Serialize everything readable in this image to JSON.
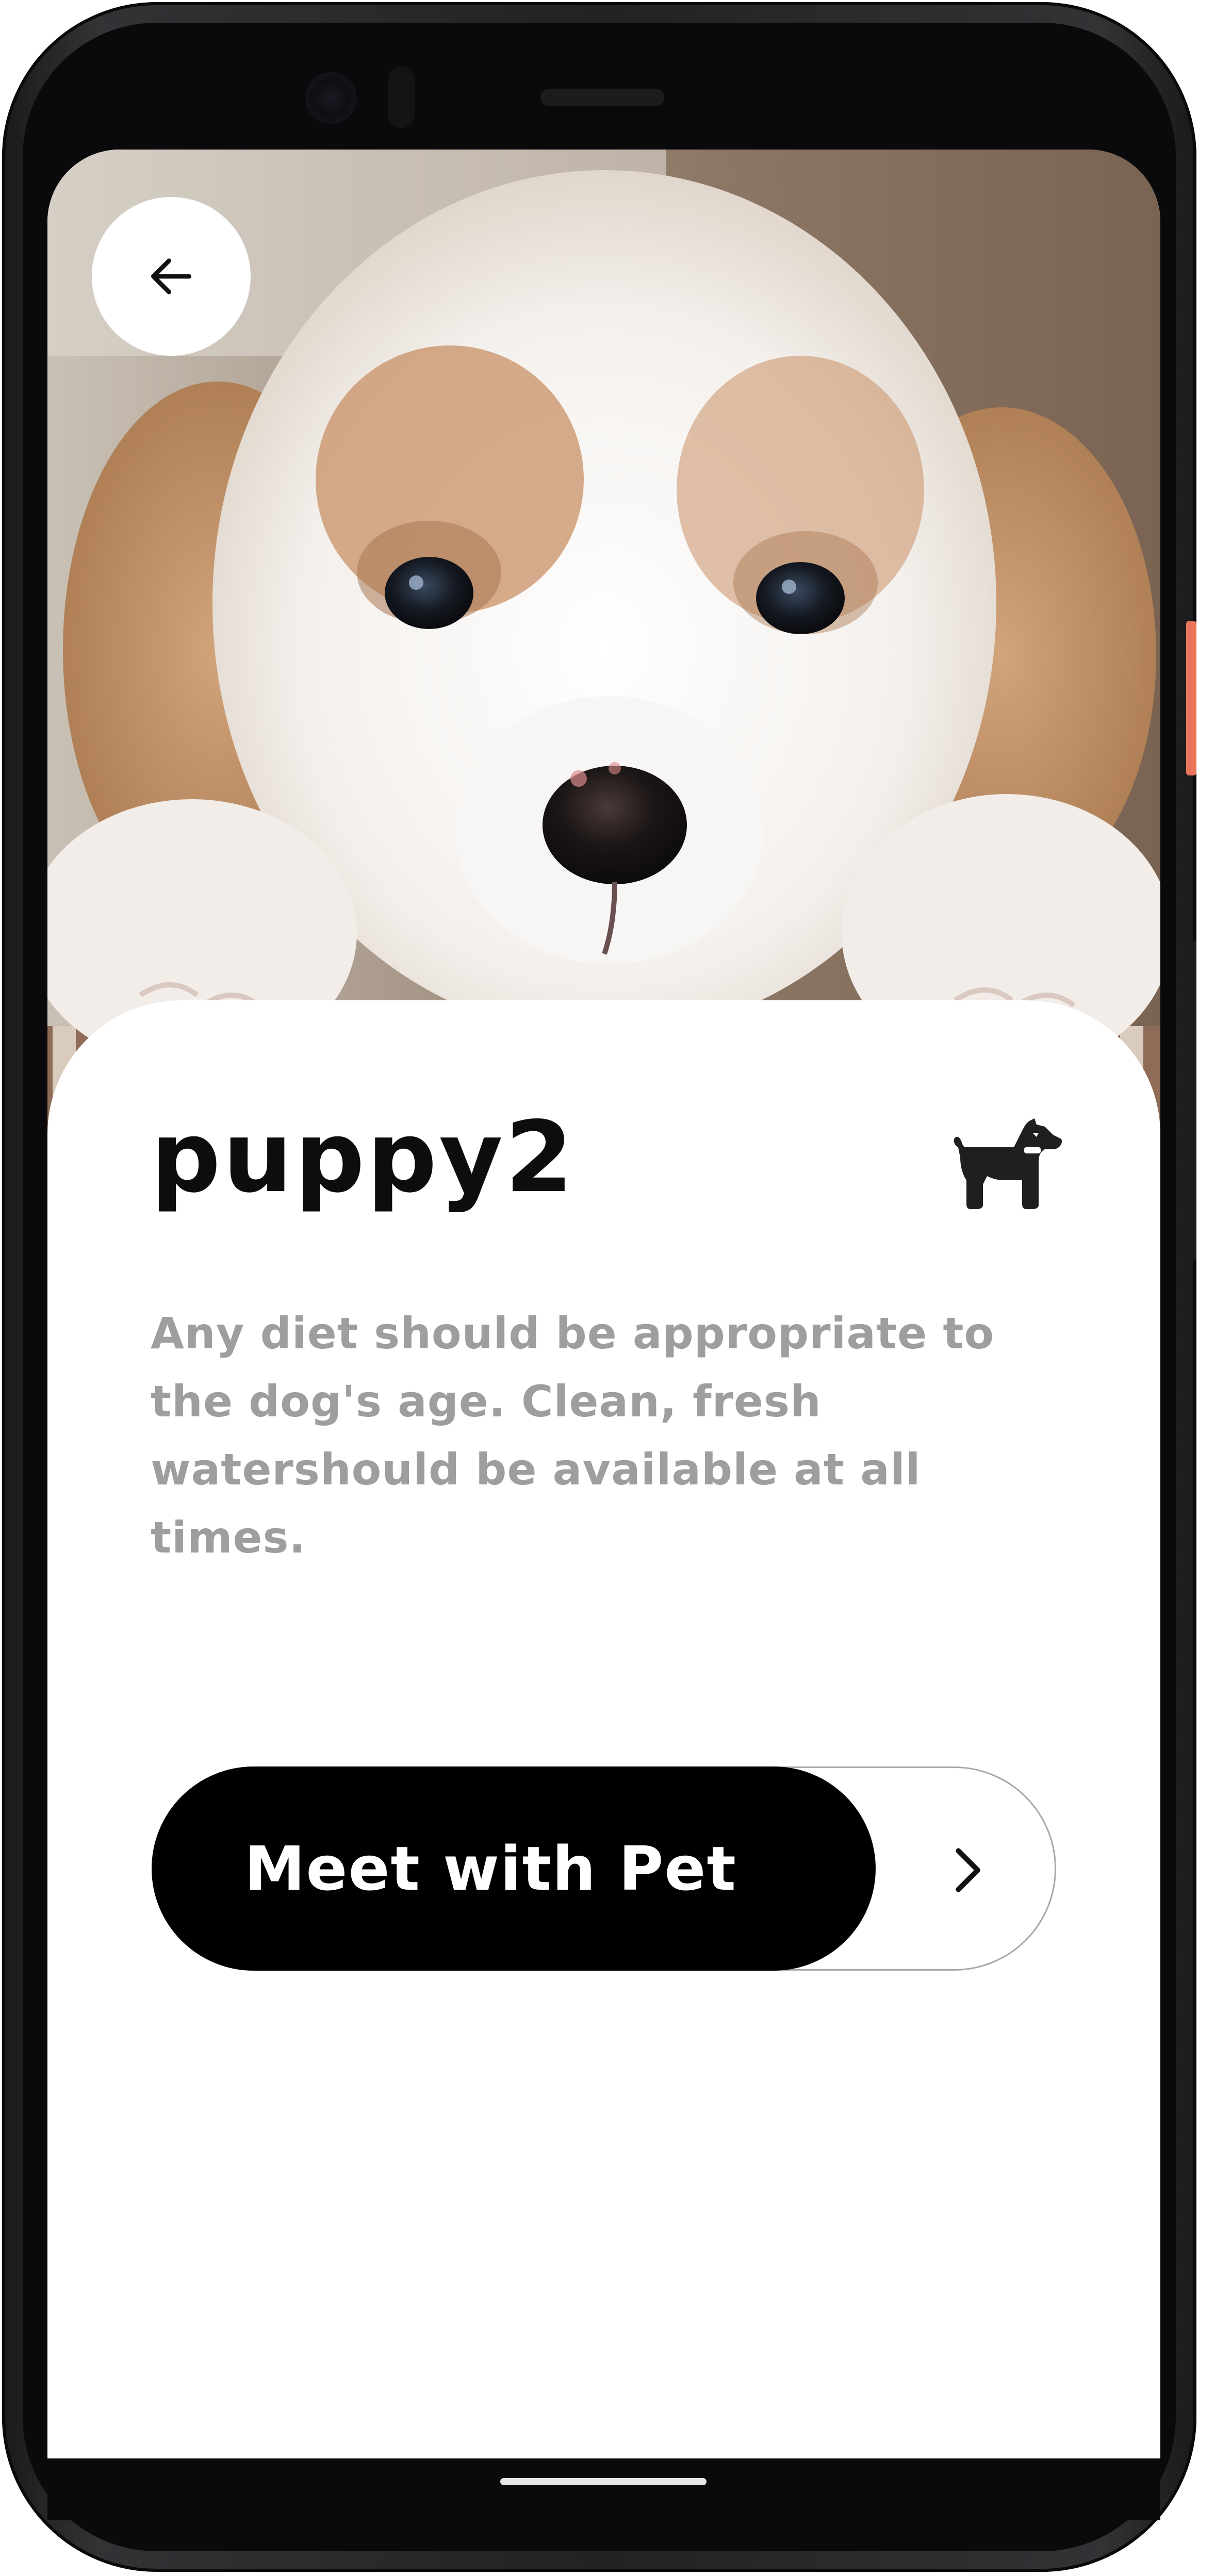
{
  "detail": {
    "name": "puppy2",
    "description": "Any diet should be appropriate to the dog's age. Clean, fresh watershould be available at all times.",
    "pet_type_icon": "dog-icon",
    "back_icon": "arrow-left-icon"
  },
  "cta": {
    "label": "Meet with Pet",
    "icon": "chevron-right-icon"
  },
  "colors": {
    "accent": "#000000",
    "description_text": "#9e9e9e",
    "card_background": "#ffffff"
  }
}
